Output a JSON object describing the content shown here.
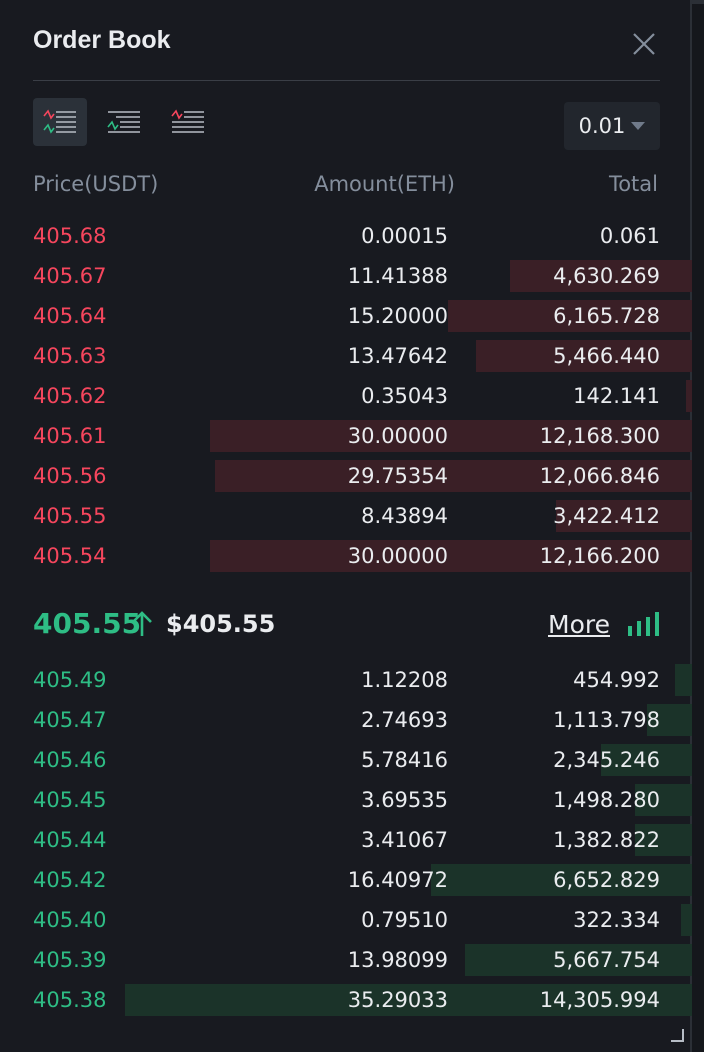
{
  "title": "Order Book",
  "precision": "0.01",
  "headers": {
    "price": "Price(USDT)",
    "amount": "Amount(ETH)",
    "total": "Total"
  },
  "asks": [
    {
      "price": "405.68",
      "amount": "0.00015",
      "total": "0.061",
      "depth": 0.0
    },
    {
      "price": "405.67",
      "amount": "11.41388",
      "total": "4,630.269",
      "depth": 0.32
    },
    {
      "price": "405.64",
      "amount": "15.20000",
      "total": "6,165.728",
      "depth": 0.43
    },
    {
      "price": "405.63",
      "amount": "13.47642",
      "total": "5,466.440",
      "depth": 0.38
    },
    {
      "price": "405.62",
      "amount": "0.35043",
      "total": "142.141",
      "depth": 0.01
    },
    {
      "price": "405.61",
      "amount": "30.00000",
      "total": "12,168.300",
      "depth": 0.85
    },
    {
      "price": "405.56",
      "amount": "29.75354",
      "total": "12,066.846",
      "depth": 0.84
    },
    {
      "price": "405.55",
      "amount": "8.43894",
      "total": "3,422.412",
      "depth": 0.24
    },
    {
      "price": "405.54",
      "amount": "30.00000",
      "total": "12,166.200",
      "depth": 0.85
    }
  ],
  "mid": {
    "price": "405.55",
    "usd": "$405.55",
    "more_label": "More"
  },
  "bids": [
    {
      "price": "405.49",
      "amount": "1.12208",
      "total": "454.992",
      "depth": 0.03
    },
    {
      "price": "405.47",
      "amount": "2.74693",
      "total": "1,113.798",
      "depth": 0.08
    },
    {
      "price": "405.46",
      "amount": "5.78416",
      "total": "2,345.246",
      "depth": 0.16
    },
    {
      "price": "405.45",
      "amount": "3.69535",
      "total": "1,498.280",
      "depth": 0.1
    },
    {
      "price": "405.44",
      "amount": "3.41067",
      "total": "1,382.822",
      "depth": 0.1
    },
    {
      "price": "405.42",
      "amount": "16.40972",
      "total": "6,652.829",
      "depth": 0.46
    },
    {
      "price": "405.40",
      "amount": "0.79510",
      "total": "322.334",
      "depth": 0.02
    },
    {
      "price": "405.39",
      "amount": "13.98099",
      "total": "5,667.754",
      "depth": 0.4
    },
    {
      "price": "405.38",
      "amount": "35.29033",
      "total": "14,305.994",
      "depth": 1.0
    }
  ],
  "colors": {
    "ask": "#f6465d",
    "bid": "#2ebd85",
    "background": "#181a20"
  },
  "icons": {
    "close": "close-icon",
    "view_both": "order-book-both-icon",
    "view_bids": "order-book-bids-icon",
    "view_asks": "order-book-asks-icon",
    "mid_arrow": "arrow-up-icon",
    "more": "signal-bars-icon",
    "resize": "resize-handle-icon"
  }
}
